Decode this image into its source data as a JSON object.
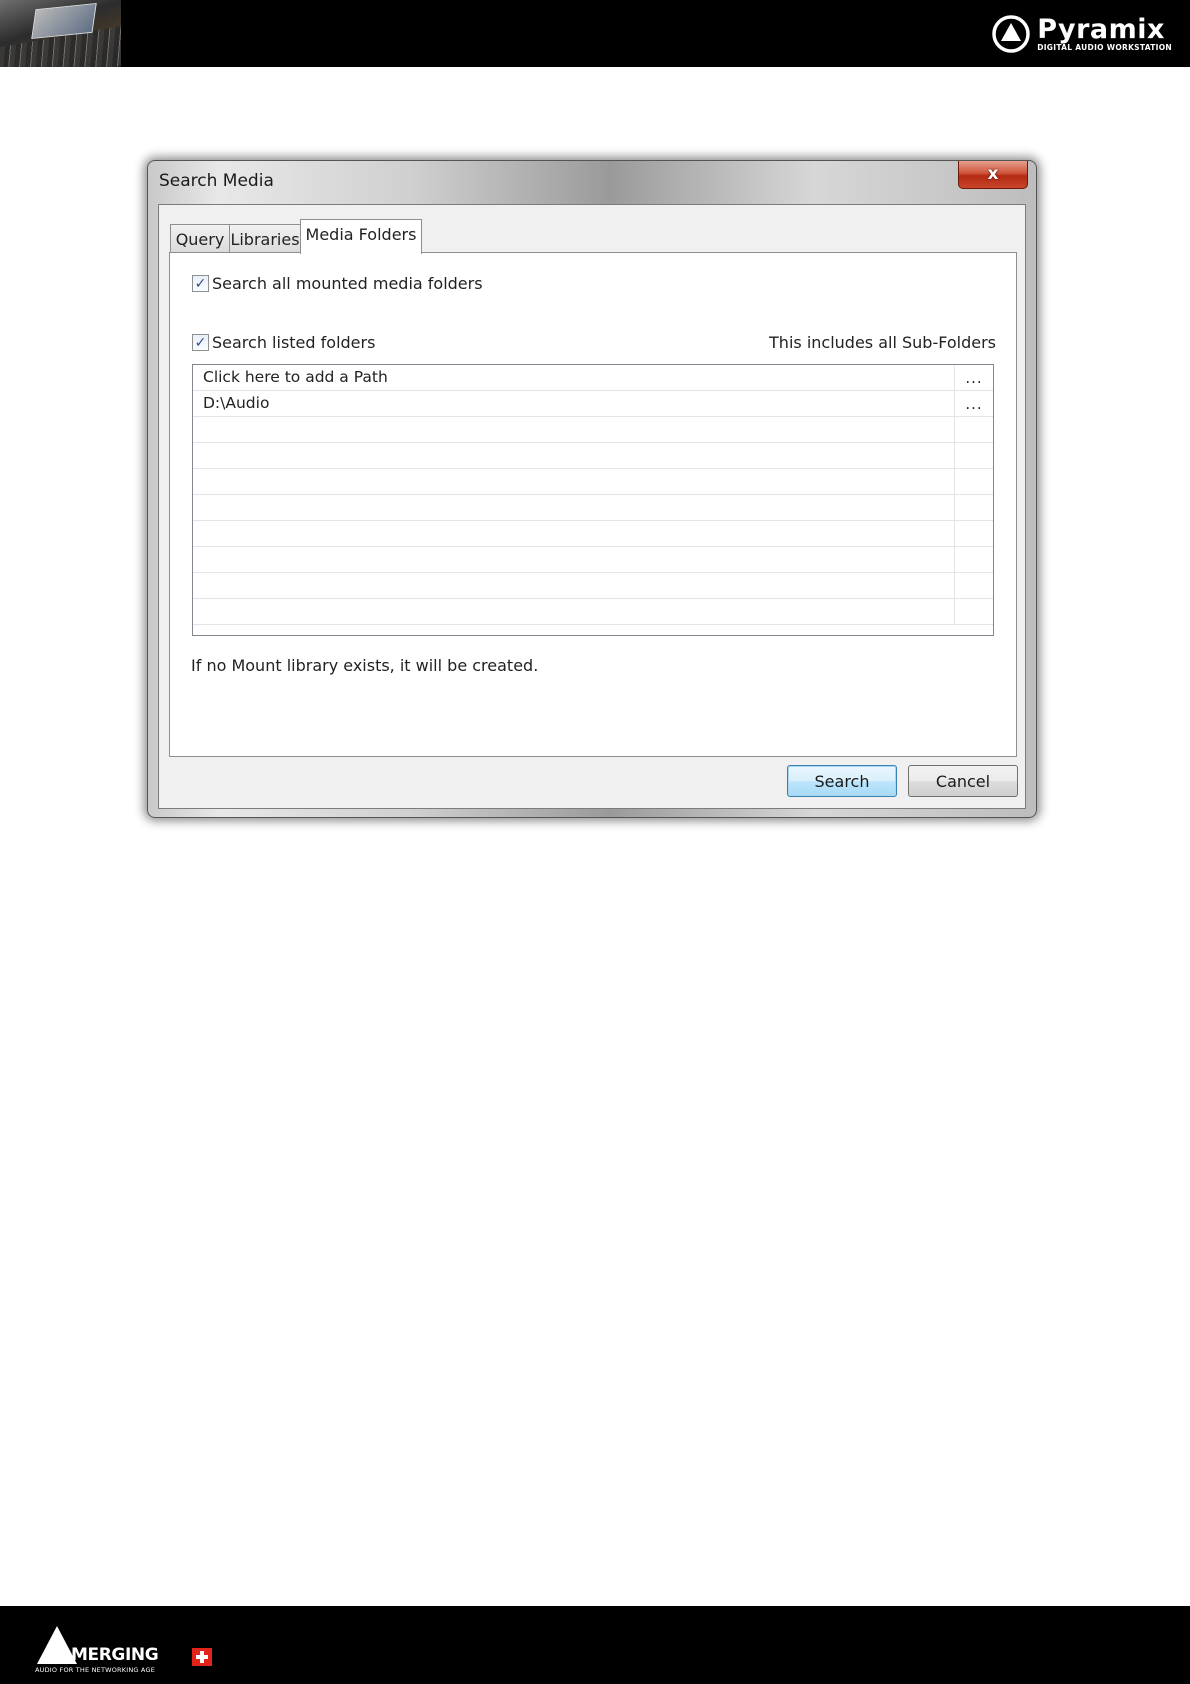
{
  "page": {
    "brand_name": "Pyramix",
    "brand_tagline": "DIGITAL AUDIO WORKSTATION",
    "footer_brand": "MERGING",
    "footer_tagline": "AUDIO FOR THE NETWORKING AGE"
  },
  "dialog": {
    "title": "Search Media",
    "close_label": "x",
    "tabs": [
      {
        "label": "Query",
        "active": false
      },
      {
        "label": "Libraries",
        "active": false
      },
      {
        "label": "Media Folders",
        "active": true
      }
    ],
    "search_mounted": {
      "label": "Search all mounted media folders",
      "checked": true
    },
    "search_listed": {
      "label": "Search listed folders",
      "checked": true
    },
    "subfolders_note": "This includes all Sub-Folders",
    "paths": [
      {
        "text": "Click here to add a Path",
        "browse": "..."
      },
      {
        "text": "D:\\Audio",
        "browse": "..."
      },
      {
        "text": "",
        "browse": ""
      },
      {
        "text": "",
        "browse": ""
      },
      {
        "text": "",
        "browse": ""
      },
      {
        "text": "",
        "browse": ""
      },
      {
        "text": "",
        "browse": ""
      },
      {
        "text": "",
        "browse": ""
      },
      {
        "text": "",
        "browse": ""
      },
      {
        "text": "",
        "browse": ""
      }
    ],
    "info": "If no Mount library exists, it will be created.",
    "buttons": {
      "search": "Search",
      "cancel": "Cancel"
    }
  },
  "colors": {
    "band": "#000000",
    "default_button_border": "#3c7fb1",
    "close_button": "#c8452b",
    "check_mark": "#2a4f8f"
  }
}
